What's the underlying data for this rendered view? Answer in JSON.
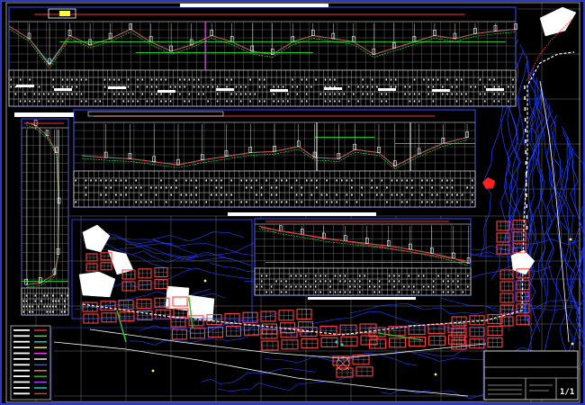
{
  "drawing": {
    "background_color": "#000000",
    "border_color": "#3a4bff",
    "grid_color": "#8a8a8a",
    "profile_colors": {
      "terrain": "#00e0e0",
      "grade": "#ff3030",
      "alt_grade": "#30ff30",
      "reference": "#ffff40",
      "axis": "#ff40ff"
    },
    "plan_colors": {
      "contours": "#2040ff",
      "blocks": "#ff4040",
      "streets": "#ffffff",
      "green_lines": "#30c030",
      "parcels": "#ffffff"
    },
    "marker_color": "#ff2020"
  },
  "title_block": {
    "sheet_number": "1/1"
  },
  "legend": {
    "entries": [
      {
        "color": "#ff3030"
      },
      {
        "color": "#30ff30"
      },
      {
        "color": "#00e0e0"
      },
      {
        "color": "#ffff40"
      },
      {
        "color": "#ff40ff"
      },
      {
        "color": "#ffffff"
      },
      {
        "color": "#3060ff"
      },
      {
        "color": "#ff8030"
      },
      {
        "color": "#30c030"
      },
      {
        "color": "#c040ff"
      },
      {
        "color": "#00e0e0"
      },
      {
        "color": "#ff3030"
      }
    ]
  }
}
